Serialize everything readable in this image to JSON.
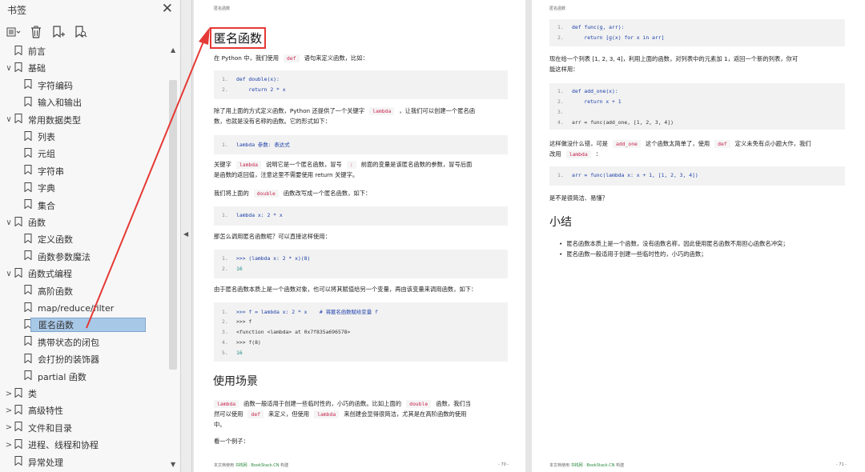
{
  "sidebar": {
    "title": "书签",
    "close_icon": "✕",
    "tools": [
      "list-view-icon",
      "delete-bookmark-icon",
      "add-bookmark-icon",
      "bookmark-search-icon"
    ],
    "items": [
      {
        "label": "前言",
        "twisty": ""
      },
      {
        "label": "基础",
        "twisty": "∨"
      },
      {
        "label": "字符编码",
        "twisty": ""
      },
      {
        "label": "输入和输出",
        "twisty": ""
      },
      {
        "label": "常用数据类型",
        "twisty": "∨"
      },
      {
        "label": "列表",
        "twisty": ""
      },
      {
        "label": "元组",
        "twisty": ""
      },
      {
        "label": "字符串",
        "twisty": ""
      },
      {
        "label": "字典",
        "twisty": ""
      },
      {
        "label": "集合",
        "twisty": ""
      },
      {
        "label": "函数",
        "twisty": "∨"
      },
      {
        "label": "定义函数",
        "twisty": ""
      },
      {
        "label": "函数参数魔法",
        "twisty": ""
      },
      {
        "label": "函数式编程",
        "twisty": "∨"
      },
      {
        "label": "高阶函数",
        "twisty": ""
      },
      {
        "label": "map/reduce/filter",
        "twisty": ""
      },
      {
        "label": "匿名函数",
        "twisty": "",
        "selected": true
      },
      {
        "label": "携带状态的闭包",
        "twisty": ""
      },
      {
        "label": "会打扮的装饰器",
        "twisty": ""
      },
      {
        "label": "partial 函数",
        "twisty": ""
      },
      {
        "label": "类",
        "twisty": ">"
      },
      {
        "label": "高级特性",
        "twisty": ">"
      },
      {
        "label": "文件和目录",
        "twisty": ">"
      },
      {
        "label": "进程、线程和协程",
        "twisty": ">"
      },
      {
        "label": "异常处理",
        "twisty": ""
      }
    ]
  },
  "page70": {
    "header": "匿名函数",
    "title": "匿名函数",
    "p1": [
      "在 Python 中，我们使用",
      "def",
      "语句来定义函数，比如："
    ],
    "code1": [
      [
        "1.",
        "def double(x):"
      ],
      [
        "2.",
        "    return 2 * x"
      ]
    ],
    "p2a": [
      "除了用上面的方式定义函数，Python 还提供了一个关键字",
      "lambda",
      "，让我们可以创建一个匿名函"
    ],
    "p2b": "数，也就是没有名称的函数。它的形式如下：",
    "code2": [
      [
        "1.",
        "lambda 参数: 表达式"
      ]
    ],
    "p3a": [
      "关键字",
      "lambda",
      "说明它是一个匿名函数，冒号",
      ":",
      "前面的变量是该匿名函数的参数，冒号后面"
    ],
    "p3b": "是函数的返回值，注意这里不需要使用 return 关键字。",
    "p4": [
      "我们将上面的",
      "double",
      "函数改写成一个匿名函数，如下："
    ],
    "code3": [
      [
        "1.",
        "lambda x: 2 * x"
      ]
    ],
    "p5": "那怎么调用匿名函数呢？可以直接这样使用：",
    "code4": [
      [
        "1.",
        ">>> (lambda x: 2 * x)(8)"
      ],
      [
        "2.",
        "16"
      ]
    ],
    "p6": "由于匿名函数本质上是一个函数对象，也可以将其赋值给另一个变量，再由该变量来调用函数，如下：",
    "code5": [
      [
        "1.",
        ">>> f = lambda x: 2 * x    # 将匿名函数赋给变量 f"
      ],
      [
        "2.",
        ">>> f"
      ],
      [
        "3.",
        "<function <lambda> at 0x7f835a696578>"
      ],
      [
        "4.",
        ">>> f(8)"
      ],
      [
        "5.",
        "16"
      ]
    ],
    "h2": "使用场景",
    "p7a": [
      "lambda",
      "函数一般适用于创建一些临时性的，小巧的函数。比如上面的",
      "double",
      "函数，我们当"
    ],
    "p7b": [
      "然可以使用",
      "def",
      "来定义，但使用",
      "lambda",
      "来创建会显得很简洁，尤其是在高阶函数的使用"
    ],
    "p7c": "中。",
    "p8": "看一个例子：",
    "footer_prefix": "本文档使用",
    "footer_site": "书栈网 · BookStack.CN",
    "footer_suffix": "构建",
    "page_num": "- 70 -"
  },
  "page71": {
    "header": "匿名函数",
    "code1": [
      [
        "1.",
        "def func(g, arr):"
      ],
      [
        "2.",
        "    return [g(x) for x in arr]"
      ]
    ],
    "p1a": "现在给一个列表 [1, 2, 3, 4]，利用上面的函数，对列表中的元素加 1，返回一个新的列表，你可",
    "p1b": "能这样用：",
    "code2": [
      [
        "1.",
        "def add_one(x):"
      ],
      [
        "2.",
        "    return x + 1"
      ],
      [
        "3.",
        ""
      ],
      [
        "4.",
        "arr = func(add_one, [1, 2, 3, 4])"
      ]
    ],
    "p2a": [
      "这样做没什么错，可是",
      "add_one",
      "这个函数太简单了，使用",
      "def",
      "定义未免有点小题大作，我们"
    ],
    "p2b": [
      "改用",
      "lambda",
      "："
    ],
    "code3": [
      [
        "1.",
        "arr = func(lambda x: x + 1, [1, 2, 3, 4])"
      ]
    ],
    "p3": "是不是很简洁、易懂？",
    "h2": "小结",
    "bullets": [
      "匿名函数本质上是一个函数，没有函数名称，因此使用匿名函数不用担心函数名冲突；",
      "匿名函数一般适用于创建一些临时性的，小巧的函数；"
    ],
    "footer_prefix": "本文档使用",
    "footer_site": "书栈网 · BookStack.CN",
    "footer_suffix": "构建",
    "page_num": "- 71 -"
  },
  "colors": {
    "selection": "#a8c8e8",
    "arrow": "#e53935",
    "inline_code": "#c7254e"
  }
}
